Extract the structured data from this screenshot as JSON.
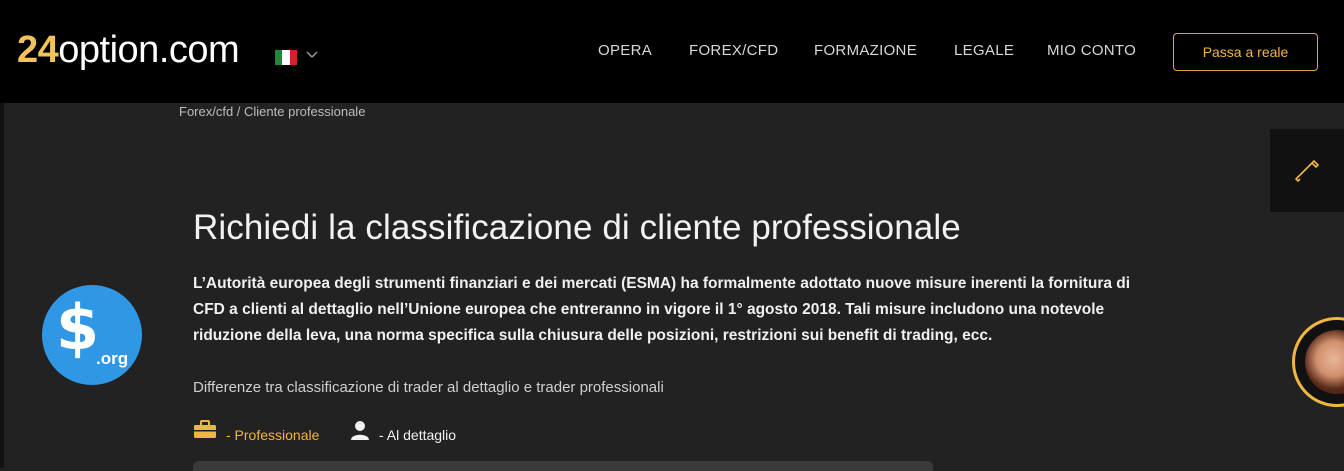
{
  "header": {
    "logo_number": "24",
    "logo_domain": "option.com",
    "language_flag": "italy-flag",
    "nav": [
      "OPERA",
      "FOREX/CFD",
      "FORMAZIONE",
      "LEGALE",
      "MIO CONTO"
    ],
    "cta_label": "Passa a reale"
  },
  "breadcrumb": "Forex/cfd / Cliente professionale",
  "main": {
    "title": "Richiedi la classificazione di cliente professionale",
    "intro": "L’Autorità europea degli strumenti finanziari e dei mercati (ESMA) ha formalmente adottato nuove misure inerenti la fornitura di CFD a clienti al dettaglio nell’Unione europea che entreranno in vigore il 1° agosto 2018. Tali misure includono una notevole riduzione della leva, una norma specifica sulla chiusura delle posizioni, restrizioni sui benefit di trading, ecc.",
    "subtitle": "Differenze tra classificazione di trader al dettaglio e trader professionali",
    "legend_professional": "- Professionale",
    "legend_retail": "- Al dettaglio"
  },
  "watermark": {
    "symbol": "$",
    "suffix": ".org"
  },
  "colors": {
    "accent": "#f1b63e",
    "background": "#222222",
    "header": "#000000",
    "watermark": "#2f97e6"
  }
}
